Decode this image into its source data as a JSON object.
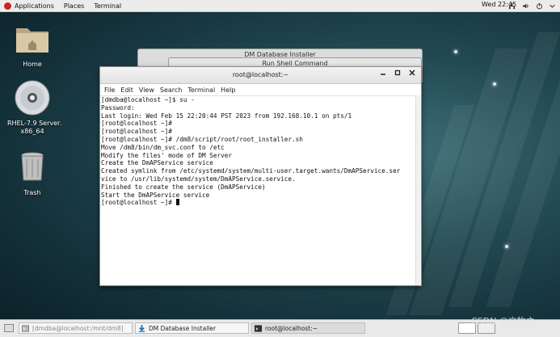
{
  "topbar": {
    "applications": "Applications",
    "places": "Places",
    "terminal": "Terminal",
    "clock": "Wed 22:45"
  },
  "desktop": {
    "home": "Home",
    "disc": "RHEL-7.9 Server.\nx86_64",
    "trash": "Trash"
  },
  "bg_windows": {
    "installer_title": "DM Database Installer",
    "run_shell_title": "Run Shell Command"
  },
  "terminal": {
    "title": "root@localhost:~",
    "menu": [
      "File",
      "Edit",
      "View",
      "Search",
      "Terminal",
      "Help"
    ],
    "lines": [
      "[dmdba@localhost ~]$ su -",
      "Password:",
      "Last login: Wed Feb 15 22:20:44 PST 2023 from 192.168.10.1 on pts/1",
      "[root@localhost ~]#",
      "[root@localhost ~]#",
      "[root@localhost ~]# /dm8/script/root/root_installer.sh",
      "Move /dm8/bin/dm_svc.conf to /etc",
      "Modify the files' mode of DM Server",
      "Create the DmAPService service",
      "Created symlink from /etc/systemd/system/multi-user.target.wants/DmAPService.ser",
      "vice to /usr/lib/systemd/system/DmAPService.service.",
      "Finished to create the service (DmAPService)",
      "Start the DmAPService service"
    ],
    "prompt": "[root@localhost ~]# "
  },
  "taskbar": {
    "task1": "[dmdba@localhost:/mnt/dm8]",
    "task2": "DM Database Installer",
    "task3": "root@localhost:~",
    "watermark": "CSDN @文牧之"
  },
  "colors": {
    "accent": "#1e73be",
    "redhat": "#cc2222"
  }
}
